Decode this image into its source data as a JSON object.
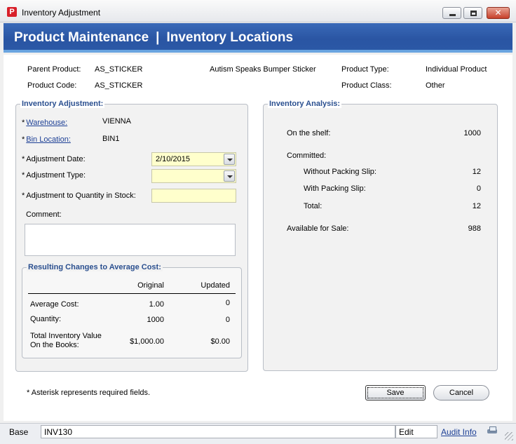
{
  "window": {
    "title": "Inventory Adjustment",
    "icon": "app-logo-icon",
    "controls": [
      "minimize-icon",
      "maximize-icon",
      "close-icon"
    ],
    "close_glyph": "✕"
  },
  "banner": {
    "title_left": "Product Maintenance",
    "separator": "|",
    "title_right": "Inventory Locations"
  },
  "product": {
    "parent_product_label": "Parent Product:",
    "parent_product_value": "AS_STICKER",
    "description": "Autism Speaks Bumper Sticker",
    "product_type_label": "Product Type:",
    "product_type_value": "Individual Product",
    "product_code_label": "Product Code:",
    "product_code_value": "AS_STICKER",
    "product_class_label": "Product Class:",
    "product_class_value": "Other"
  },
  "adjustment": {
    "group_title": "Inventory Adjustment:",
    "asterisk": "*",
    "warehouse_label": "Warehouse:",
    "warehouse_value": "VIENNA",
    "bin_label": "Bin Location:",
    "bin_value": "BIN1",
    "date_label": "Adjustment Date:",
    "date_value": "2/10/2015",
    "type_label": "Adjustment Type:",
    "type_value": "",
    "qty_label": "Adjustment to Quantity in Stock:",
    "qty_value": "",
    "comment_label": "Comment:",
    "comment_value": ""
  },
  "cost_changes": {
    "group_title": "Resulting Changes to Average Cost:",
    "col_original": "Original",
    "col_updated": "Updated",
    "rows": [
      {
        "label": "Average Cost:",
        "original": "1.00",
        "updated": "0"
      },
      {
        "label": "Quantity:",
        "original": "1000",
        "updated": "0"
      },
      {
        "label_line1": "Total Inventory Value",
        "label_line2": "On the Books:",
        "original": "$1,000.00",
        "updated": "$0.00"
      }
    ]
  },
  "analysis": {
    "group_title": "Inventory Analysis:",
    "on_shelf_label": "On the shelf:",
    "on_shelf_value": "1000",
    "committed_label": "Committed:",
    "without_slip_label": "Without Packing Slip:",
    "without_slip_value": "12",
    "with_slip_label": "With Packing Slip:",
    "with_slip_value": "0",
    "total_label": "Total:",
    "total_value": "12",
    "available_label": "Available for Sale:",
    "available_value": "988"
  },
  "footer": {
    "required_note": "* Asterisk represents required fields.",
    "save_label": "Save",
    "cancel_label": "Cancel"
  },
  "statusbar": {
    "base": "Base",
    "form_id": "INV130",
    "mode": "Edit",
    "audit_link": "Audit Info",
    "printer_icon": "printer-icon"
  }
}
